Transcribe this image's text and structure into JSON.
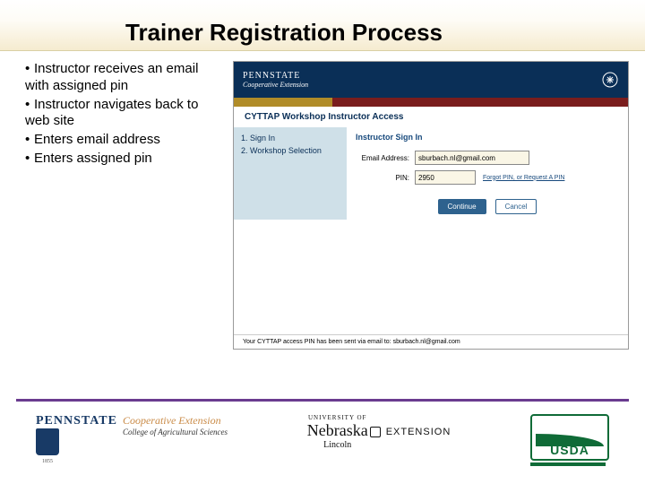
{
  "title": "Trainer Registration Process",
  "bullets": [
    "Instructor receives an email with assigned pin",
    "Instructor navigates back to web site",
    "Enters email address",
    "Enters assigned pin"
  ],
  "screenshot": {
    "brand": "PENNSTATE",
    "brand_sub": "Cooperative Extension",
    "page_heading": "CYTTAP Workshop Instructor Access",
    "nav": {
      "item1": "1. Sign In",
      "item2": "2. Workshop Selection"
    },
    "section_heading": "Instructor Sign In",
    "email_label": "Email Address:",
    "email_value": "sburbach.nl@gmail.com",
    "pin_label": "PIN:",
    "pin_value": "2950",
    "forgot_link": "Forgot PIN, or Request A PIN",
    "btn_continue": "Continue",
    "btn_cancel": "Cancel",
    "confirm_msg": "Your CYTTAP access PIN has been sent via email to: sburbach.nl@gmail.com"
  },
  "logos": {
    "pennstate": {
      "name": "PENNSTATE",
      "year": "1855",
      "coop": "Cooperative Extension",
      "college": "College of Agricultural Sciences"
    },
    "nebraska": {
      "line1": "UNIVERSITY OF",
      "line2": "Nebraska",
      "city": "Lincoln",
      "ext": "EXTENSION"
    },
    "usda": {
      "text": "USDA"
    }
  }
}
